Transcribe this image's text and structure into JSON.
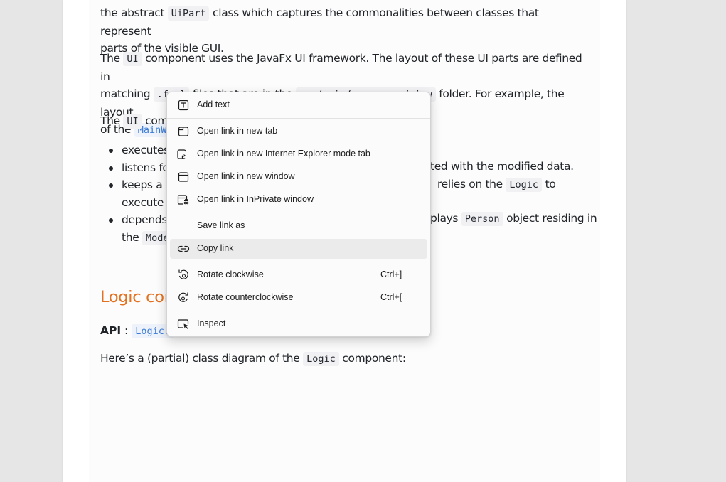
{
  "doc": {
    "p1": {
      "before": "the abstract ",
      "code1": "UiPart",
      "after": " class which captures the commonalities between classes that represent",
      "line2": "parts of the visible GUI."
    },
    "p2": {
      "t1": "The ",
      "code1": "UI",
      "t2": " component uses the JavaFx UI framework. The layout of these UI parts are defined in",
      "t3": "matching ",
      "code2": ".fxml",
      "t4": " files that are in the ",
      "code3": "src/main/resources/view",
      "t5": " folder. For example, the layout",
      "t6": "of the ",
      "code4": "MainWi"
    },
    "p3": {
      "t1": "The ",
      "code1": "UI",
      "t2": " com"
    },
    "bullets": {
      "b1": "executes",
      "b2": "listens fo",
      "b2_right": "ted with the modified data.",
      "b3": "keeps a r",
      "b3_right_a": "relies on the ",
      "b3_code": "Logic",
      "b3_right_b": " to",
      "b3_line2": "execute c",
      "b4": "depends",
      "b4_right_a": "plays ",
      "b4_code": "Person",
      "b4_right_b": " object residing in",
      "b4_line2": "the ",
      "b4_code2": "Mode"
    },
    "heading": "Logic com",
    "api": {
      "label": "API",
      "colon": " : ",
      "code": "Logic."
    },
    "p4": {
      "t1": "Here’s a (partial) class diagram of the ",
      "code": "Logic",
      "t2": " component:"
    }
  },
  "context_menu": {
    "items": [
      {
        "label": "Add text",
        "icon": "add-text-icon"
      },
      {
        "label": "Open link in new tab",
        "icon": "new-tab-icon"
      },
      {
        "label": "Open link in new Internet Explorer mode tab",
        "icon": "ie-mode-icon"
      },
      {
        "label": "Open link in new window",
        "icon": "new-window-icon"
      },
      {
        "label": "Open link in InPrivate window",
        "icon": "inprivate-icon"
      },
      {
        "label": "Save link as",
        "icon": ""
      },
      {
        "label": "Copy link",
        "icon": "link-icon"
      },
      {
        "label": "Rotate clockwise",
        "icon": "rotate-clockwise-icon",
        "shortcut": "Ctrl+]"
      },
      {
        "label": "Rotate counterclockwise",
        "icon": "rotate-counterclockwise-icon",
        "shortcut": "Ctrl+["
      },
      {
        "label": "Inspect",
        "icon": "inspect-icon"
      }
    ],
    "hovered": "Copy link"
  },
  "colors": {
    "heading": "#e3711f",
    "link_code": "#3b7bd8",
    "menu_hover": "#ebebeb",
    "ie_icon": "#1a1a1a"
  }
}
